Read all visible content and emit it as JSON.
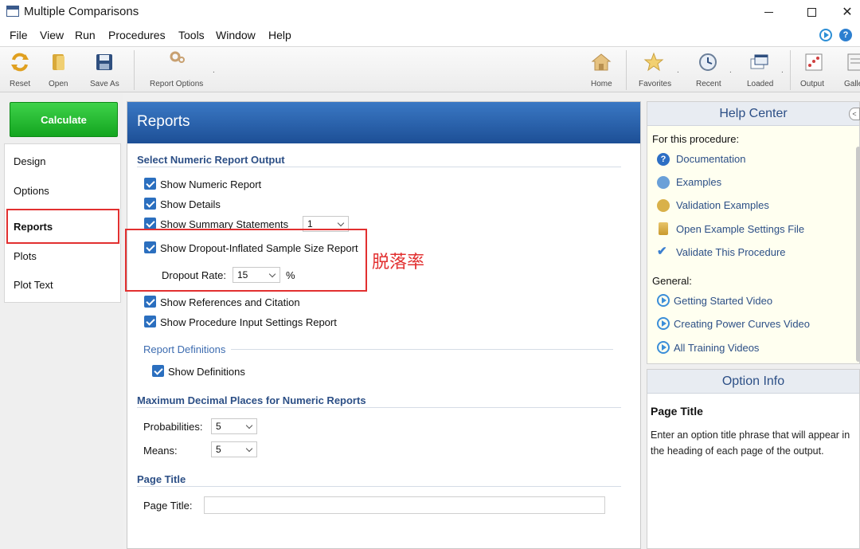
{
  "window": {
    "title": "Multiple Comparisons"
  },
  "menu": [
    "File",
    "View",
    "Run",
    "Procedures",
    "Tools",
    "Window",
    "Help"
  ],
  "toolbar": {
    "reset": "Reset",
    "open": "Open",
    "save_as": "Save As",
    "report_options": "Report Options",
    "home": "Home",
    "favorites": "Favorites",
    "recent": "Recent",
    "loaded": "Loaded",
    "output": "Output",
    "gallery": "Galle"
  },
  "calculate_label": "Calculate",
  "nav": {
    "items": [
      "Design",
      "Options",
      "Reports",
      "Plots",
      "Plot Text"
    ],
    "active": "Reports"
  },
  "main": {
    "title": "Reports",
    "section_numeric": "Select Numeric Report Output",
    "checks": {
      "show_numeric": "Show Numeric Report",
      "show_details": "Show Details",
      "show_summary": "Show Summary Statements",
      "show_dropout": "Show Dropout-Inflated Sample Size Report",
      "show_refs": "Show References and Citation",
      "show_input": "Show Procedure Input Settings Report",
      "show_defs": "Show Definitions"
    },
    "summary_value": "1",
    "dropout_label": "Dropout Rate:",
    "dropout_value": "15",
    "percent": "%",
    "annotation": "脱落率",
    "report_defs": "Report Definitions",
    "section_decimal": "Maximum Decimal Places for Numeric Reports",
    "prob_label": "Probabilities:",
    "prob_value": "5",
    "means_label": "Means:",
    "means_value": "5",
    "section_page": "Page Title",
    "page_title_label": "Page Title:",
    "page_title_value": ""
  },
  "help_center": {
    "title": "Help Center",
    "for_procedure": "For this procedure:",
    "links": [
      "Documentation",
      "Examples",
      "Validation Examples",
      "Open Example Settings File",
      "Validate This Procedure"
    ],
    "general": "General:",
    "videos": [
      "Getting Started Video",
      "Creating Power Curves Video",
      "All Training Videos"
    ]
  },
  "option_info": {
    "title": "Option Info",
    "heading": "Page Title",
    "description": "Enter an option title phrase that will appear in the heading of each page of the output."
  },
  "colors": {
    "accent": "#2c4f86",
    "calculate": "#1bb327",
    "annotation": "#e23030",
    "header": "#2a63ad"
  }
}
